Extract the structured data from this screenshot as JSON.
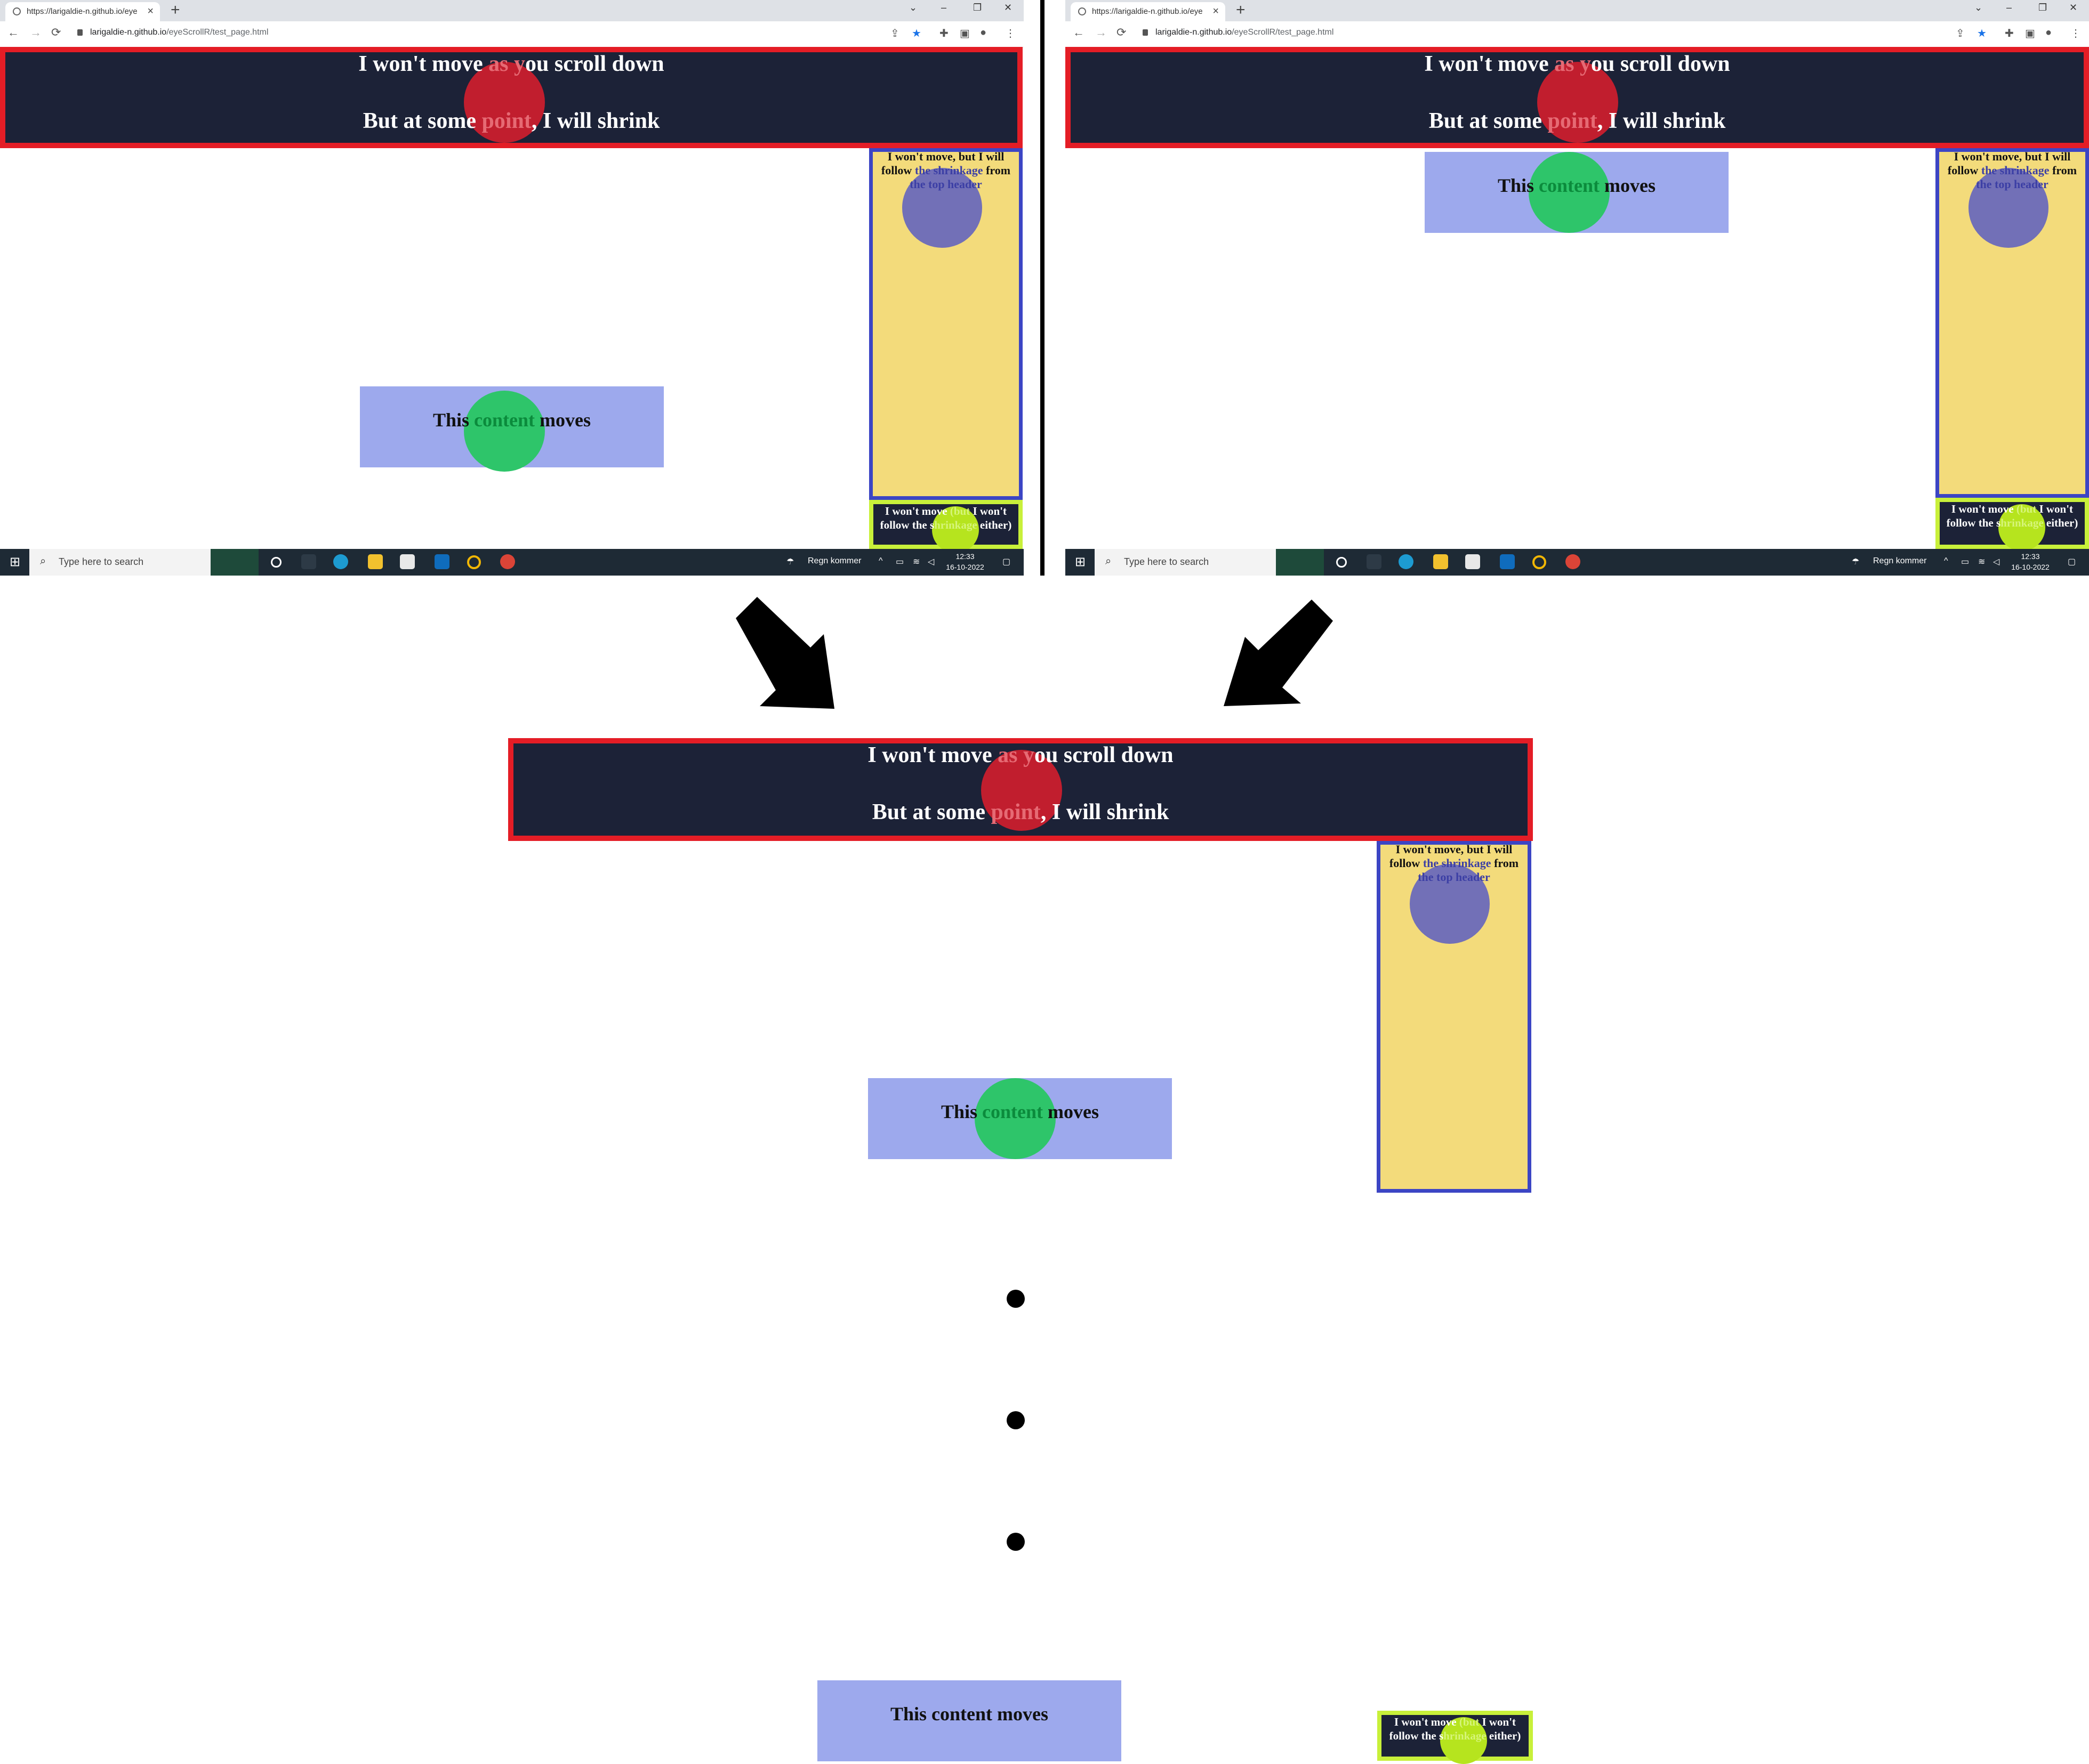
{
  "browser": {
    "tab_title": "https://larigaldie-n.github.io/eye",
    "tab_close": "×",
    "new_tab": "+",
    "url_host": "larigaldie-n.github.io",
    "url_path": "/eyeScrollR/test_page.html",
    "back": "←",
    "forward": "→",
    "reload": "⟳",
    "minimize": "–",
    "restore": "❐",
    "close": "✕",
    "chevron": "⌄",
    "star": "★",
    "menu": "⋮"
  },
  "page": {
    "header_line1_a": "I won't move ",
    "header_line1_red": "as y",
    "header_line1_b": "ou scroll down",
    "header_line2_a": "But at some ",
    "header_line2_red": "point",
    "header_line2_b": ", I will shrink",
    "mover_a": "This ",
    "mover_green": "content",
    "mover_b": " moves",
    "mover_plain": "This content moves",
    "side_a": "I won't move, but I will follow ",
    "side_blue": "the shrinkage",
    "side_b": " from ",
    "side_blue2": "the top header",
    "footer_a": "I won't move ",
    "footer_lime": "(but",
    "footer_b": " I won't follow the s",
    "footer_lime2": "hrinkage",
    "footer_c": " either)"
  },
  "taskbar": {
    "search_placeholder": "Type here to search",
    "weather": "Regn kommer",
    "time": "12:33",
    "date": "16-10-2022",
    "start": "⊞"
  },
  "colors": {
    "header_bg": "#1c2237",
    "header_border": "#e41d26",
    "mover_bg": "#9da9ed",
    "side_bg": "#f3db7b",
    "side_border": "#3c45c4",
    "footer_border": "#c8f03a",
    "gaze_red": "#cd1e2d",
    "gaze_green": "#2ec56a",
    "gaze_blue": "#6464be",
    "gaze_lime": "#b6e41e"
  }
}
